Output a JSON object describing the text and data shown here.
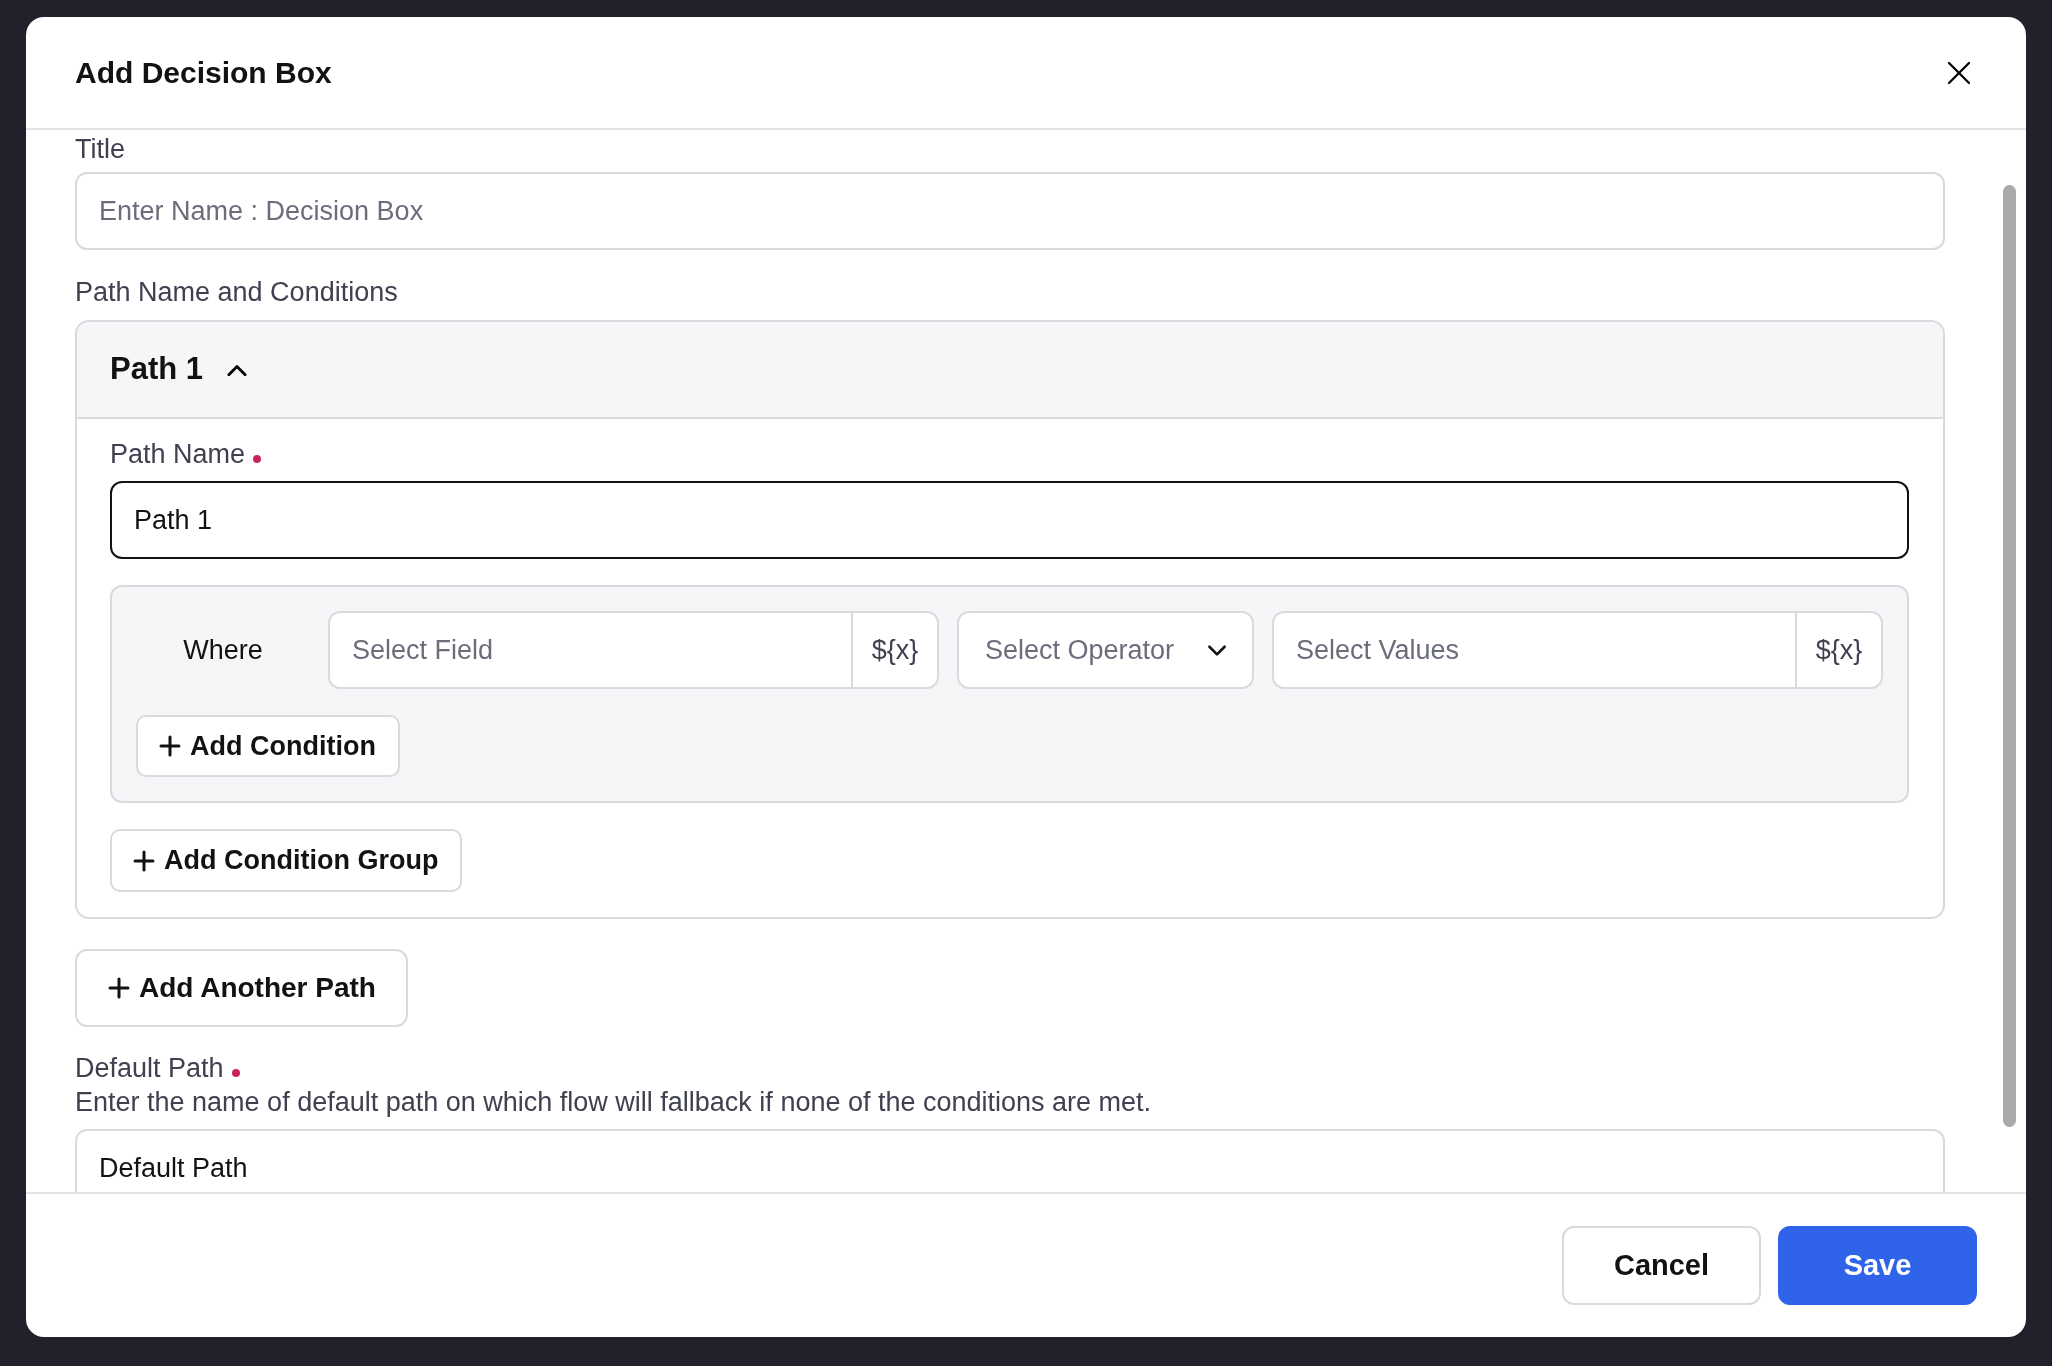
{
  "dialog": {
    "title": "Add Decision Box"
  },
  "title_field": {
    "label": "Title",
    "placeholder": "Enter Name : Decision Box"
  },
  "section_label": "Path Name and Conditions",
  "paths": [
    {
      "title": "Path 1",
      "expanded": true,
      "name_label": "Path Name",
      "required": true,
      "name_value": "Path 1",
      "add_group": "Add Condition Group",
      "condition_groups": [
        {
          "where": "Where",
          "field_placeholder": "Select Field",
          "field_variable": "${x}",
          "operator_placeholder": "Select Operator",
          "values_placeholder": "Select Values",
          "values_variable": "${x}",
          "add_condition": "Add Condition"
        }
      ]
    }
  ],
  "add_path": "Add Another Path",
  "default_path": {
    "label": "Default Path",
    "required": true,
    "help": "Enter the name of default path on which flow will fallback if none of the conditions are met.",
    "value": "Default Path"
  },
  "buttons": [
    {
      "label": "Cancel",
      "kind": "secondary"
    },
    {
      "label": "Save",
      "kind": "primary"
    }
  ]
}
